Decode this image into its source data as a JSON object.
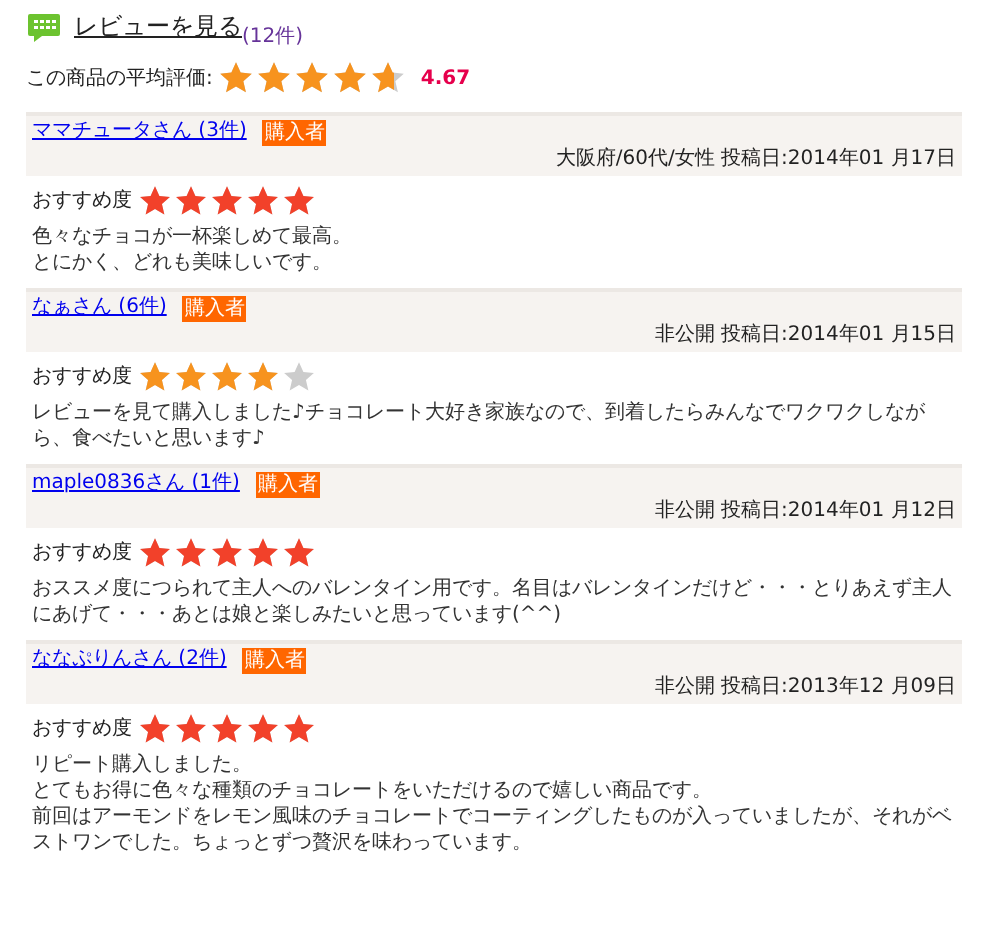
{
  "header": {
    "link": "レビューを見る",
    "count": "(12件)"
  },
  "average": {
    "label": "この商品の平均評価:",
    "stars": 4.67,
    "score": "4.67"
  },
  "reviews": [
    {
      "name": "ママチュータさん (3件)",
      "badge": "購入者",
      "meta": "大阪府/60代/女性 投稿日:2014年01 月17日",
      "rating_label": "おすすめ度",
      "stars": 5,
      "body": [
        "色々なチョコが一杯楽しめて最高。",
        "とにかく、どれも美味しいです。"
      ]
    },
    {
      "name": "なぁさん (6件)",
      "badge": "購入者",
      "meta": "非公開 投稿日:2014年01 月15日",
      "rating_label": "おすすめ度",
      "stars": 4,
      "body": [
        "レビューを見て購入しました♪チョコレート大好き家族なので、到着したらみんなでワクワクしながら、食べたいと思います♪"
      ]
    },
    {
      "name": "maple0836さん (1件)",
      "badge": "購入者",
      "meta": "非公開 投稿日:2014年01 月12日",
      "rating_label": "おすすめ度",
      "stars": 5,
      "body": [
        "おススメ度につられて主人へのバレンタイン用です。名目はバレンタインだけど・・・とりあえず主人にあげて・・・あとは娘と楽しみたいと思っています(^^)"
      ]
    },
    {
      "name": "ななぷりんさん (2件)",
      "badge": "購入者",
      "meta": "非公開 投稿日:2013年12 月09日",
      "rating_label": "おすすめ度",
      "stars": 5,
      "body": [
        "リピート購入しました。",
        "とてもお得に色々な種類のチョコレートをいただけるので嬉しい商品です。",
        "前回はアーモンドをレモン風味のチョコレートでコーティングしたものが入っていましたが、それがベストワンでした。ちょっとずつ贅沢を味わっています。"
      ]
    }
  ]
}
